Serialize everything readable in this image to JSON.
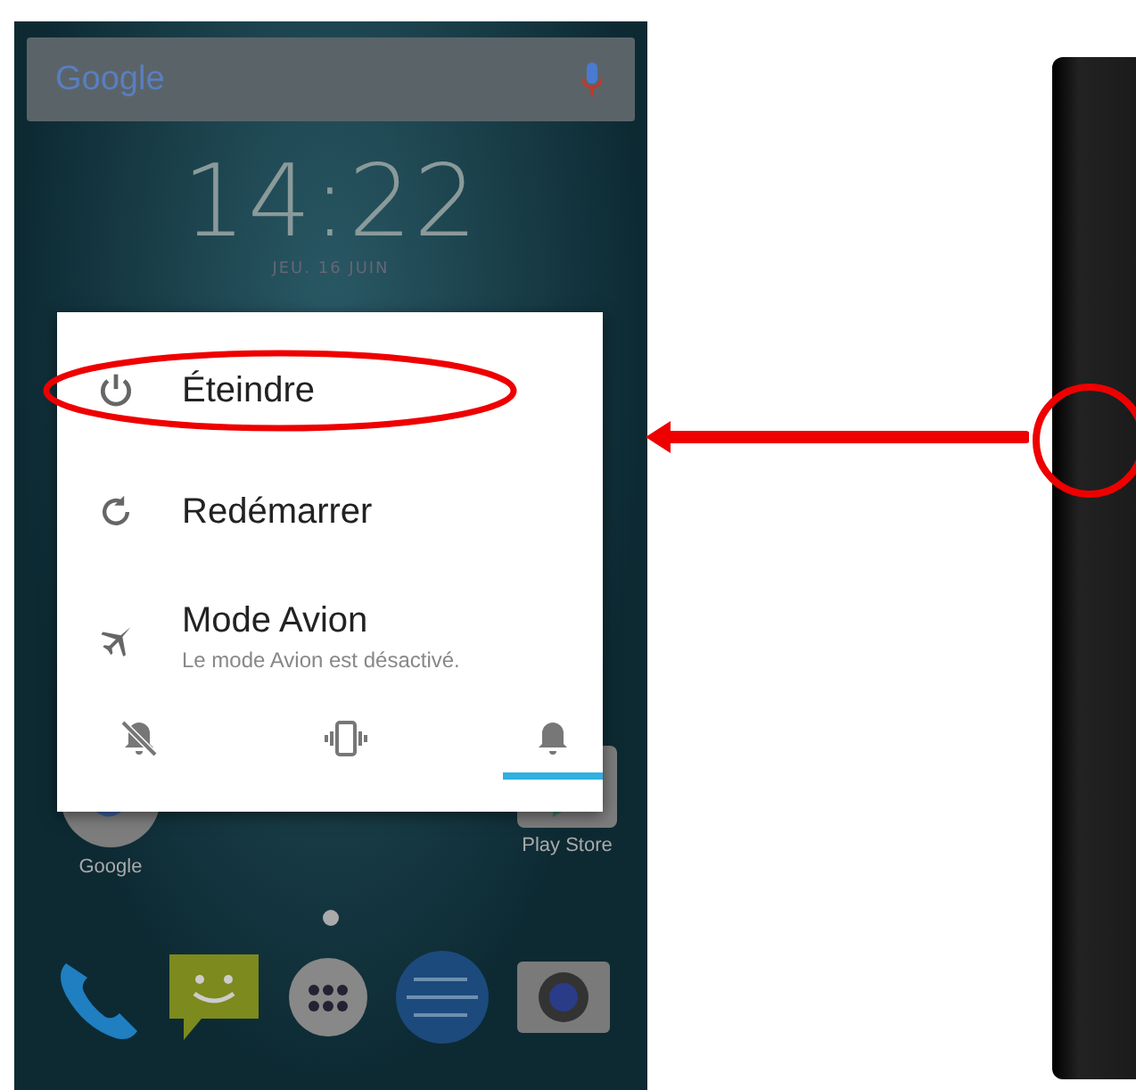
{
  "search_bar": {
    "logo": "Google"
  },
  "clock": {
    "time": "14:22",
    "date": "JEU. 16 JUIN"
  },
  "power_menu": {
    "items": [
      {
        "kind": "power",
        "label": "Éteindre",
        "highlighted": true
      },
      {
        "kind": "restart",
        "label": "Redémarrer",
        "highlighted": false
      },
      {
        "kind": "airplane",
        "label": "Mode Avion",
        "subtitle": "Le mode Avion est désactivé.",
        "highlighted": false
      }
    ],
    "sound_modes": [
      {
        "kind": "silent",
        "selected": false
      },
      {
        "kind": "vibrate",
        "selected": false
      },
      {
        "kind": "ring",
        "selected": true
      }
    ]
  },
  "home_apps": [
    {
      "kind": "google",
      "label": "Google"
    },
    {
      "kind": "playstore",
      "label": "Play Store"
    }
  ],
  "dock": [
    {
      "kind": "phone"
    },
    {
      "kind": "messages"
    },
    {
      "kind": "apps"
    },
    {
      "kind": "browser"
    },
    {
      "kind": "camera"
    }
  ]
}
